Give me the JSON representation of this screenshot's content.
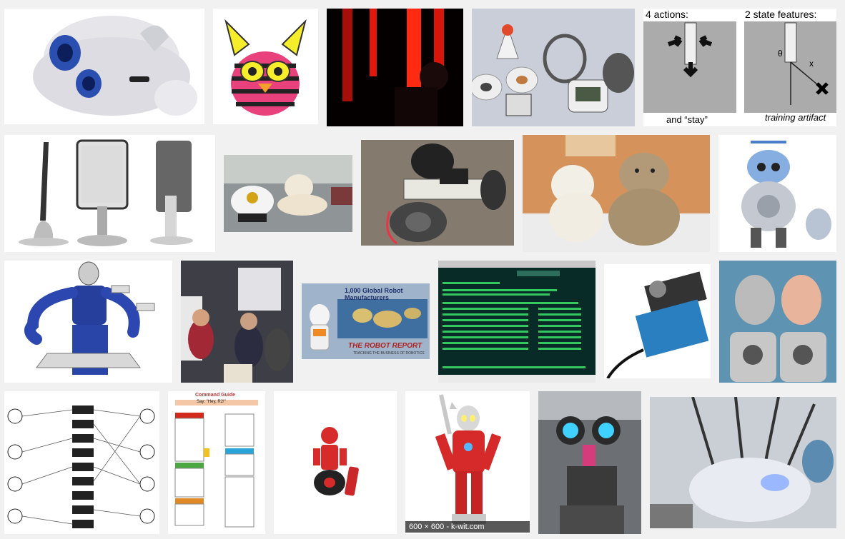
{
  "grid": {
    "tiles": [
      {
        "alt": "white robot dog"
      },
      {
        "alt": "pink striped furby"
      },
      {
        "alt": "red light columns in dark room"
      },
      {
        "alt": "toy robot kit with discs"
      },
      {
        "alt": "actions and state features diagram"
      },
      {
        "alt": "tablet stands"
      },
      {
        "alt": "robot dog and small dog"
      },
      {
        "alt": "wheeled breadboard robot"
      },
      {
        "alt": "teddy bears"
      },
      {
        "alt": "silver toy robot with propeller"
      },
      {
        "alt": "blue humanoid robot render"
      },
      {
        "alt": "people at exhibition"
      },
      {
        "alt": "nao robot with world map"
      },
      {
        "alt": "terminal screen"
      },
      {
        "alt": "servo motor"
      },
      {
        "alt": "two robot heads"
      },
      {
        "alt": "path diagram"
      },
      {
        "alt": "command guide"
      },
      {
        "alt": "small red robot toy"
      },
      {
        "alt": "red ultraman robot toy"
      },
      {
        "alt": "robot with glowing blue eyes"
      },
      {
        "alt": "surgical robot"
      }
    ]
  },
  "rl_diagram": {
    "actions_label": "4 actions:",
    "state_label": "2 state features:",
    "stay_label": "and “stay”",
    "theta_label": "θ",
    "x_label": "x",
    "artifact_label": "training artifact"
  },
  "robot_report": {
    "headline": "1,000 Global Robot Manufacturers",
    "brand": "THE ROBOT REPORT",
    "tagline": "TRACKING THE BUSINESS OF ROBOTICS"
  },
  "command_guide": {
    "title": "Command Guide",
    "subtitle": "Say: \"Hey, R2!\""
  },
  "hover_overlay": {
    "size_text": "600 × 600",
    "domain_text": "k-wit.com"
  },
  "colors": {
    "page_bg": "#f1f1f1",
    "terminal_bg": "#0a2f2a",
    "terminal_text": "#3ee36b"
  }
}
